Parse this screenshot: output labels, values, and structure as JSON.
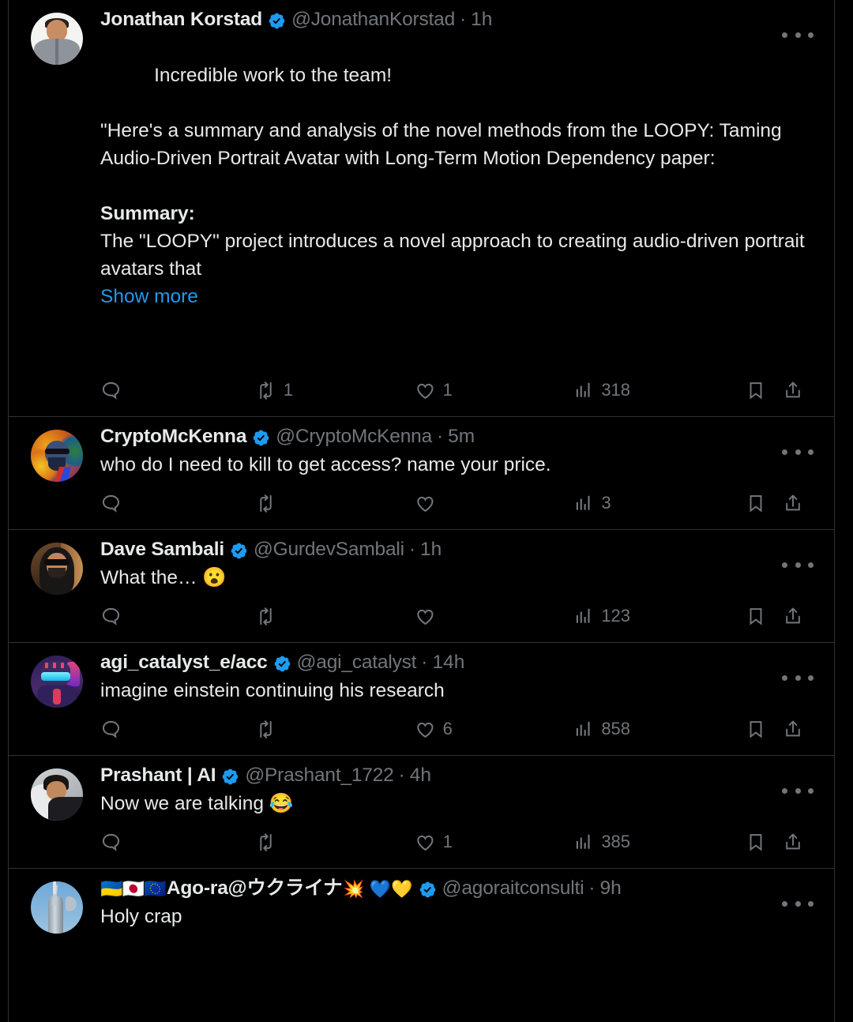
{
  "colors": {
    "background": "#000000",
    "text_primary": "#e7e9ea",
    "text_secondary": "#71767b",
    "link": "#1d9bf0",
    "verified_badge": "#1d9bf0",
    "divider": "#2f3336"
  },
  "icons": {
    "reply": "reply-icon",
    "retweet": "retweet-icon",
    "like": "like-heart-icon",
    "views": "views-bar-chart-icon",
    "bookmark": "bookmark-icon",
    "share": "share-icon",
    "more": "more-options-icon",
    "verified": "verified-badge-icon"
  },
  "tweets": [
    {
      "name": "Jonathan Korstad",
      "verified": true,
      "handle": "@JonathanKorstad",
      "time": "1h",
      "avatar": "man-in-gray-patterned-shirt",
      "text_blocks": [
        {
          "style": "normal",
          "text": "Incredible work to the team!"
        },
        {
          "style": "blank",
          "text": ""
        },
        {
          "style": "normal",
          "text": "\"Here's a summary and analysis of the novel methods from the LOOPY: Taming Audio-Driven Portrait Avatar with Long-Term Motion Dependency paper:"
        },
        {
          "style": "blank",
          "text": ""
        },
        {
          "style": "bold",
          "text": "Summary:"
        },
        {
          "style": "normal",
          "text": "The \"LOOPY\" project introduces a novel approach to creating audio-driven portrait avatars that"
        }
      ],
      "show_more": "Show more",
      "actions": {
        "reply": "",
        "retweet": "1",
        "like": "1",
        "views": "318"
      }
    },
    {
      "name": "CryptoMcKenna",
      "verified": true,
      "handle": "@CryptoMcKenna",
      "time": "5m",
      "avatar": "psychedelic-colorful-portrait",
      "text_blocks": [
        {
          "style": "normal",
          "text": "who do I need to kill to get access? name your price."
        }
      ],
      "show_more": "",
      "actions": {
        "reply": "",
        "retweet": "",
        "like": "",
        "views": "3"
      }
    },
    {
      "name": "Dave Sambali",
      "verified": true,
      "handle": "@GurdevSambali",
      "time": "1h",
      "avatar": "man-with-sunglasses-long-hair",
      "text_blocks": [
        {
          "style": "normal",
          "text": "What the… 😮"
        }
      ],
      "show_more": "",
      "actions": {
        "reply": "",
        "retweet": "",
        "like": "",
        "views": "123"
      }
    },
    {
      "name": "agi_catalyst_e/acc",
      "verified": true,
      "handle": "@agi_catalyst",
      "time": "14h",
      "avatar": "cyberpunk-mecha-avatar",
      "text_blocks": [
        {
          "style": "normal",
          "text": "imagine einstein continuing his research"
        }
      ],
      "show_more": "",
      "actions": {
        "reply": "",
        "retweet": "",
        "like": "6",
        "views": "858"
      }
    },
    {
      "name": "Prashant | AI",
      "verified": true,
      "handle": "@Prashant_1722",
      "time": "4h",
      "avatar": "man-lying-down-portrait",
      "text_blocks": [
        {
          "style": "normal",
          "text": "Now we are talking 😂"
        }
      ],
      "show_more": "",
      "actions": {
        "reply": "",
        "retweet": "",
        "like": "1",
        "views": "385"
      }
    },
    {
      "name": "Ago-ra@ウクライナ",
      "name_prefix_flags": "🇺🇦🇯🇵🇪🇺",
      "name_suffix_emoji": "💥 💙💛",
      "verified": true,
      "handle": "@agoraitconsulti",
      "time": "9h",
      "avatar": "motherland-statue-blue-sky",
      "text_blocks": [
        {
          "style": "normal",
          "text": "Holy crap"
        }
      ],
      "show_more": "",
      "actions": {
        "reply": "",
        "retweet": "",
        "like": "",
        "views": ""
      }
    }
  ]
}
